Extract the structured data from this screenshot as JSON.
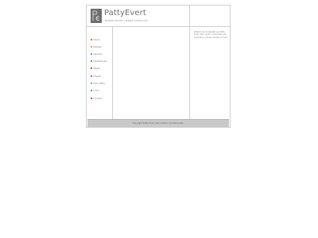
{
  "header": {
    "brand_name": "PattyEvert",
    "brand_tagline": "NEDERLANDSE LIEDJES SCHRIJVER"
  },
  "nav": {
    "items": [
      {
        "label": "Home",
        "color": "#e8742a"
      },
      {
        "label": "Nieuws",
        "color": "#e8a52a"
      },
      {
        "label": "Agenda",
        "color": "#6a8fd8"
      },
      {
        "label": "Gastenboek",
        "color": "#4fae5a"
      },
      {
        "label": "Media",
        "color": "#c14f4f"
      },
      {
        "label": "Muziek",
        "color": "#8e6fd0"
      },
      {
        "label": "Over Patty",
        "color": "#9a9a9a"
      },
      {
        "label": "Links",
        "color": "#4aa6c4"
      },
      {
        "label": "Contact",
        "color": "#d85050"
      }
    ]
  },
  "sidebar": {
    "text": "Welkom op de website van Patty Evert. Hier vindt u informatie over optredens, nieuwe muziek en meer."
  },
  "footer": {
    "text": "Copyright Patty Evert. Alle rechten voorbehouden."
  }
}
